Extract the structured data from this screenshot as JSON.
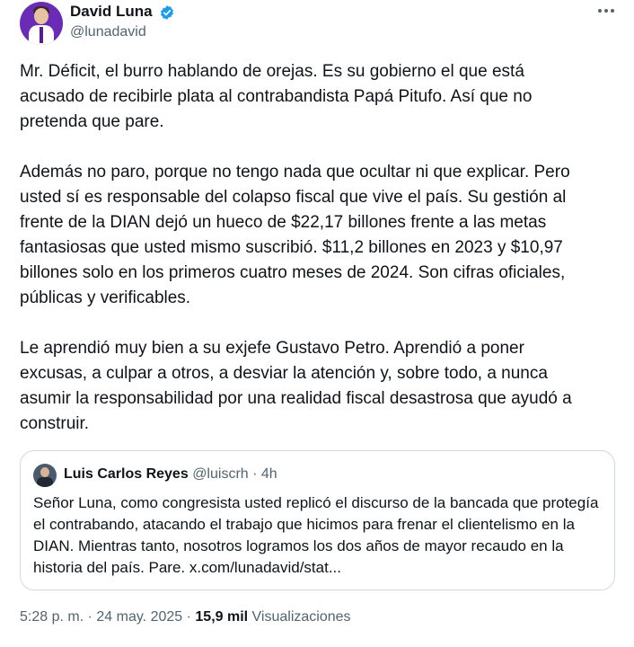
{
  "author": {
    "name": "David Luna",
    "handle": "@lunadavid",
    "verified_icon": "verified-badge-icon",
    "verified_color": "#1d9bf0"
  },
  "tweet": {
    "paragraphs": [
      "Mr. Déficit, el burro hablando de orejas. Es su gobierno el que está\nacusado de recibirle plata al contrabandista Papá Pitufo. Así que no\npretenda que pare.",
      "Además no paro, porque no tengo nada que ocultar ni que explicar. Pero\nusted sí es responsable del colapso fiscal que vive el país. Su gestión al\nfrente de la DIAN dejó un hueco de $22,17 billones frente a las metas\nfantasiosas que usted mismo suscribió. $11,2 billones en 2023 y $10,97\nbillones solo en los primeros cuatro meses de 2024. Son cifras oficiales,\npúblicas y verificables.",
      "Le aprendió muy bien a su exjefe Gustavo Petro. Aprendió a poner\nexcusas, a culpar a otros, a desviar la atención y, sobre todo, a nunca\nasumir la responsabilidad por una realidad fiscal desastrosa que ayudó a\nconstruir."
    ]
  },
  "quote": {
    "name": "Luis Carlos Reyes",
    "handle": "@luiscrh",
    "separator": "·",
    "time": "4h",
    "text": "Señor Luna, como congresista usted replicó el discurso de la bancada que protegía el contrabando, atacando el trabajo que hicimos para frenar el clientelismo en la DIAN. Mientras tanto, nosotros logramos los dos años de mayor recaudo en la historia del país. Pare. x.com/lunadavid/stat..."
  },
  "footer": {
    "time": "5:28 p. m.",
    "separator": "·",
    "date": "24 may. 2025",
    "views_count": "15,9 mil",
    "views_label": "Visualizaciones"
  }
}
